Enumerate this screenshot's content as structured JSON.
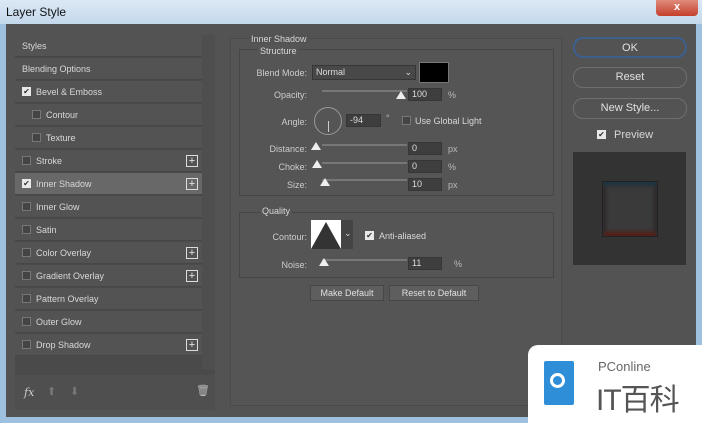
{
  "window": {
    "title": "Layer Style",
    "close": "x"
  },
  "styles_list": [
    {
      "label": "Styles",
      "checkbox": null,
      "plus": false,
      "indent": false
    },
    {
      "label": "Blending Options",
      "checkbox": null,
      "plus": false,
      "indent": false
    },
    {
      "label": "Bevel & Emboss",
      "checkbox": true,
      "plus": false,
      "indent": false
    },
    {
      "label": "Contour",
      "checkbox": false,
      "plus": false,
      "indent": true
    },
    {
      "label": "Texture",
      "checkbox": false,
      "plus": false,
      "indent": true
    },
    {
      "label": "Stroke",
      "checkbox": false,
      "plus": true,
      "indent": false
    },
    {
      "label": "Inner Shadow",
      "checkbox": true,
      "plus": true,
      "indent": false,
      "selected": true
    },
    {
      "label": "Inner Glow",
      "checkbox": false,
      "plus": false,
      "indent": false
    },
    {
      "label": "Satin",
      "checkbox": false,
      "plus": false,
      "indent": false
    },
    {
      "label": "Color Overlay",
      "checkbox": false,
      "plus": true,
      "indent": false
    },
    {
      "label": "Gradient Overlay",
      "checkbox": false,
      "plus": true,
      "indent": false
    },
    {
      "label": "Pattern Overlay",
      "checkbox": false,
      "plus": false,
      "indent": false
    },
    {
      "label": "Outer Glow",
      "checkbox": false,
      "plus": false,
      "indent": false
    },
    {
      "label": "Drop Shadow",
      "checkbox": false,
      "plus": true,
      "indent": false
    }
  ],
  "footer": {
    "fx": "fx"
  },
  "inner_shadow": {
    "title": "Inner Shadow",
    "structure": {
      "title": "Structure",
      "blend_mode_label": "Blend Mode:",
      "blend_mode": "Normal",
      "color": "#000000",
      "opacity_label": "Opacity:",
      "opacity": "100",
      "opacity_unit": "%",
      "angle_label": "Angle:",
      "angle": "-94",
      "angle_unit": "°",
      "global_light_label": "Use Global Light",
      "global_light": false,
      "distance_label": "Distance:",
      "distance": "0",
      "distance_unit": "px",
      "choke_label": "Choke:",
      "choke": "0",
      "choke_unit": "%",
      "size_label": "Size:",
      "size": "10",
      "size_unit": "px"
    },
    "quality": {
      "title": "Quality",
      "contour_label": "Contour:",
      "anti_aliased_label": "Anti-aliased",
      "anti_aliased": true,
      "noise_label": "Noise:",
      "noise": "11",
      "noise_unit": "%"
    },
    "make_default": "Make Default",
    "reset_default": "Reset to Default"
  },
  "buttons": {
    "ok": "OK",
    "reset": "Reset",
    "new_style": "New Style...",
    "preview_label": "Preview",
    "preview": true
  },
  "watermark": {
    "brand": "PConline",
    "name": "IT百科"
  }
}
